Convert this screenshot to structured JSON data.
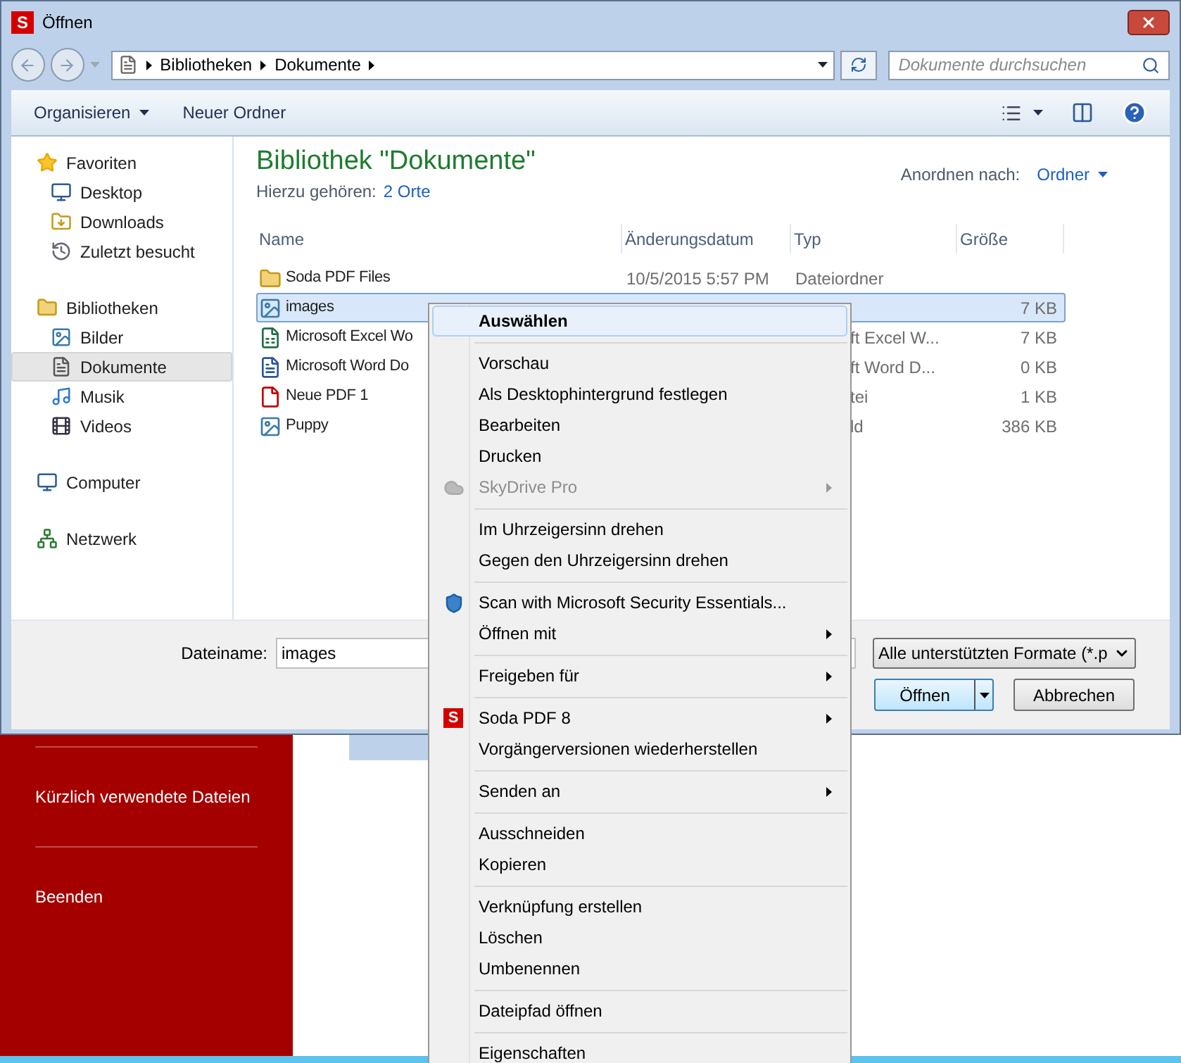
{
  "window": {
    "logo": "S",
    "title": "Öffnen"
  },
  "address": {
    "crumbs": [
      "Bibliotheken",
      "Dokumente"
    ]
  },
  "search": {
    "placeholder": "Dokumente durchsuchen"
  },
  "toolbar": {
    "organize": "Organisieren",
    "new_folder": "Neuer Ordner"
  },
  "sidebar": {
    "groups": [
      {
        "label": "Favoriten",
        "selected": false,
        "children": [
          {
            "label": "Desktop",
            "selected": false
          },
          {
            "label": "Downloads",
            "selected": false
          },
          {
            "label": "Zuletzt besucht",
            "selected": false
          }
        ]
      },
      {
        "label": "Bibliotheken",
        "selected": false,
        "children": [
          {
            "label": "Bilder",
            "selected": false
          },
          {
            "label": "Dokumente",
            "selected": true
          },
          {
            "label": "Musik",
            "selected": false
          },
          {
            "label": "Videos",
            "selected": false
          }
        ]
      },
      {
        "label": "Computer",
        "selected": false
      },
      {
        "label": "Netzwerk",
        "selected": false
      }
    ]
  },
  "library": {
    "title": "Bibliothek \"Dokumente\"",
    "includes_label": "Hierzu gehören:",
    "includes_link": "2 Orte",
    "arrange_label": "Anordnen nach:",
    "arrange_value": "Ordner"
  },
  "table": {
    "columns": [
      "Name",
      "Änderungsdatum",
      "Typ",
      "Größe"
    ],
    "rows": [
      {
        "kind": "folder",
        "name": "Soda PDF Files",
        "date": "10/5/2015 5:57 PM",
        "type": "Dateiordner",
        "selected": false
      },
      {
        "kind": "image",
        "name": "images",
        "size": "7 KB",
        "selected": true
      },
      {
        "kind": "excel",
        "name": "Microsoft Excel Wo",
        "type": "ft Excel W...",
        "size": "7 KB",
        "selected": false
      },
      {
        "kind": "word",
        "name": "Microsoft Word Do",
        "type": "ft Word D...",
        "size": "0 KB",
        "selected": false
      },
      {
        "kind": "pdf",
        "name": "Neue PDF 1",
        "type": "tei",
        "size": "1 KB",
        "selected": false
      },
      {
        "kind": "image",
        "name": "Puppy",
        "type": "ld",
        "size": "386 KB",
        "selected": false
      }
    ]
  },
  "footer": {
    "filename_label": "Dateiname:",
    "filename_value": "images",
    "filter": "Alle unterstützten Formate (*.p",
    "open": "Öffnen",
    "cancel": "Abbrechen"
  },
  "background_app": {
    "items": [
      "Kürzlich verwendete Dateien",
      "Beenden"
    ]
  },
  "context_menu": {
    "items": [
      {
        "kind": "item",
        "label": "Auswählen",
        "default": true,
        "highlighted": true,
        "disabled": false,
        "submenu": false
      },
      {
        "kind": "separator"
      },
      {
        "kind": "item",
        "label": "Vorschau",
        "default": false,
        "highlighted": false,
        "disabled": false,
        "submenu": false
      },
      {
        "kind": "item",
        "label": "Als Desktophintergrund festlegen",
        "default": false,
        "highlighted": false,
        "disabled": false,
        "submenu": false
      },
      {
        "kind": "item",
        "label": "Bearbeiten",
        "default": false,
        "highlighted": false,
        "disabled": false,
        "submenu": false
      },
      {
        "kind": "item",
        "label": "Drucken",
        "default": false,
        "highlighted": false,
        "disabled": false,
        "submenu": false
      },
      {
        "kind": "cloud",
        "label": "SkyDrive Pro",
        "default": false,
        "highlighted": false,
        "disabled": true,
        "submenu": true
      },
      {
        "kind": "separator"
      },
      {
        "kind": "item",
        "label": "Im Uhrzeigersinn drehen",
        "default": false,
        "highlighted": false,
        "disabled": false,
        "submenu": false
      },
      {
        "kind": "item",
        "label": "Gegen den Uhrzeigersinn drehen",
        "default": false,
        "highlighted": false,
        "disabled": false,
        "submenu": false
      },
      {
        "kind": "separator"
      },
      {
        "kind": "scanner",
        "label": "Scan with Microsoft Security Essentials...",
        "default": false,
        "highlighted": false,
        "disabled": false,
        "submenu": false
      },
      {
        "kind": "item",
        "label": "Öffnen mit",
        "default": false,
        "highlighted": false,
        "disabled": false,
        "submenu": true
      },
      {
        "kind": "separator"
      },
      {
        "kind": "item",
        "label": "Freigeben für",
        "default": false,
        "highlighted": false,
        "disabled": false,
        "submenu": true
      },
      {
        "kind": "separator"
      },
      {
        "kind": "badge",
        "badge": "S",
        "label": "Soda PDF 8",
        "default": false,
        "highlighted": false,
        "disabled": false,
        "submenu": true
      },
      {
        "kind": "item",
        "label": "Vorgängerversionen wiederherstellen",
        "default": false,
        "highlighted": false,
        "disabled": false,
        "submenu": false
      },
      {
        "kind": "separator"
      },
      {
        "kind": "item",
        "label": "Senden an",
        "default": false,
        "highlighted": false,
        "disabled": false,
        "submenu": true
      },
      {
        "kind": "separator"
      },
      {
        "kind": "item",
        "label": "Ausschneiden",
        "default": false,
        "highlighted": false,
        "disabled": false,
        "submenu": false
      },
      {
        "kind": "item",
        "label": "Kopieren",
        "default": false,
        "highlighted": false,
        "disabled": false,
        "submenu": false
      },
      {
        "kind": "separator"
      },
      {
        "kind": "item",
        "label": "Verknüpfung erstellen",
        "default": false,
        "highlighted": false,
        "disabled": false,
        "submenu": false
      },
      {
        "kind": "item",
        "label": "Löschen",
        "default": false,
        "highlighted": false,
        "disabled": false,
        "submenu": false
      },
      {
        "kind": "item",
        "label": "Umbenennen",
        "default": false,
        "highlighted": false,
        "disabled": false,
        "submenu": false
      },
      {
        "kind": "separator"
      },
      {
        "kind": "item",
        "label": "Dateipfad öffnen",
        "default": false,
        "highlighted": false,
        "disabled": false,
        "submenu": false
      },
      {
        "kind": "separator"
      },
      {
        "kind": "item",
        "label": "Eigenschaften",
        "default": false,
        "highlighted": false,
        "disabled": false,
        "submenu": false
      }
    ]
  }
}
